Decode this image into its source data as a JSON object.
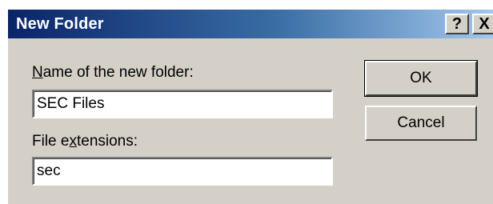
{
  "dialog": {
    "title": "New Folder",
    "help_label": "?",
    "close_label": "X"
  },
  "form": {
    "name_label_mnemonic": "N",
    "name_label_rest": "ame of the new folder:",
    "name_value": "SEC Files",
    "ext_label_before": "File e",
    "ext_label_mnemonic": "x",
    "ext_label_after": "tensions:",
    "ext_value": "sec"
  },
  "buttons": {
    "ok_label": "OK",
    "cancel_label": "Cancel"
  }
}
